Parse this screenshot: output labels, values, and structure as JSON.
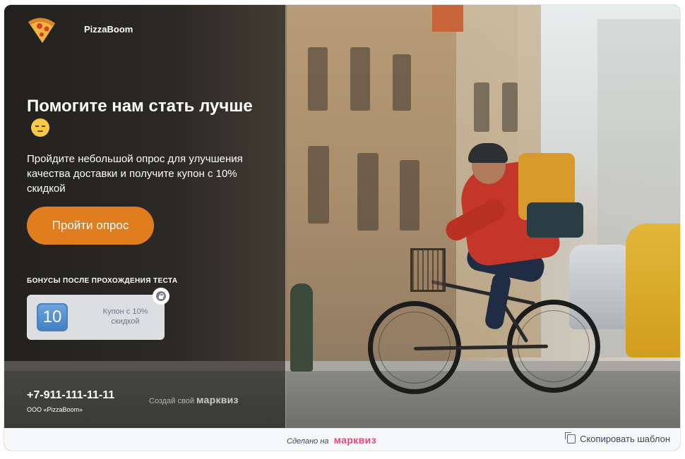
{
  "brand": {
    "name": "PizzaBoom",
    "logo_icon": "pizza-slice-icon"
  },
  "hero": {
    "title": "Помогите нам стать лучше",
    "title_emoji": "pensive-face-emoji",
    "description": "Пройдите небольшой опрос для улучшения качества доставки и получите купон с 10% скидкой",
    "cta_label": "Пройти опрос"
  },
  "bonus": {
    "heading": "БОНУСЫ ПОСЛЕ ПРОХОЖДЕНИЯ ТЕСТА",
    "badge": "10",
    "text": "Купон с 10% скидкой",
    "icon": "lock-icon"
  },
  "contacts": {
    "phone": "+7-911-111-11-11",
    "company": "ООО «PizzaBoom»"
  },
  "promo": {
    "prefix": "Создай свой",
    "brand": "марквиз"
  },
  "footer": {
    "made_on": "Сделано на",
    "made_on_brand": "марквиз",
    "copy_label": "Скопировать шаблон",
    "copy_icon": "copy-icon"
  },
  "colors": {
    "accent": "#e07d1f",
    "brand_pink": "#e8457a"
  }
}
